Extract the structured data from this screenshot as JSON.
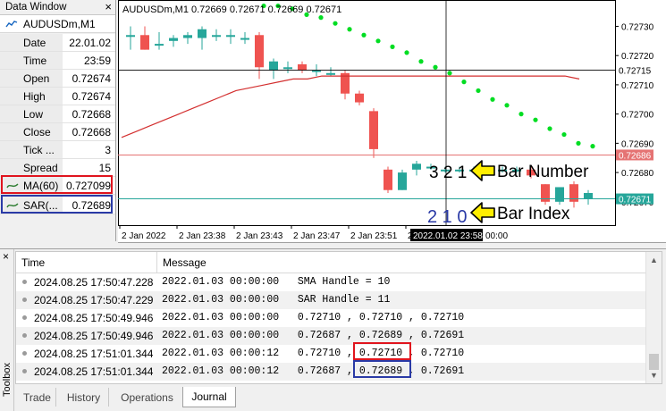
{
  "data_window": {
    "title": "Data Window",
    "close": "×",
    "symbol": "AUDUSDm,M1",
    "rows": [
      {
        "label": "Date",
        "value": "22.01.02"
      },
      {
        "label": "Time",
        "value": "23:59"
      },
      {
        "label": "Open",
        "value": "0.72674"
      },
      {
        "label": "High",
        "value": "0.72674"
      },
      {
        "label": "Low",
        "value": "0.72668"
      },
      {
        "label": "Close",
        "value": "0.72668"
      },
      {
        "label": "Tick ...",
        "value": "3"
      },
      {
        "label": "Spread",
        "value": "15"
      },
      {
        "label": "MA(60)",
        "value": "0.727099"
      },
      {
        "label": "SAR(...",
        "value": "0.72689"
      }
    ]
  },
  "chart": {
    "title": "AUDUSDm,M1  0.72669 0.72671 0.72669 0.72671",
    "crosshair_x_label": "2022.01.02 23:58",
    "x_tick_trailing": "00:00",
    "price_ticks": [
      "0.72730",
      "0.72720",
      "0.72710",
      "0.72700",
      "0.72690",
      "0.72680",
      "0.72670"
    ],
    "time_ticks": [
      "2 Jan 2022",
      "2 Jan 23:38",
      "2 Jan 23:43",
      "2 Jan 23:47",
      "2 Jan 23:51",
      "2 Jan 23:55"
    ],
    "price_tags": {
      "crosshair": "0.72715",
      "red_line": "0.72686",
      "green_line": "0.72671"
    },
    "annotations": {
      "bar_number_digits": "3 2 1",
      "bar_number_label": "Bar Number",
      "bar_index_digits": "2 1 0",
      "bar_index_label": "Bar Index"
    },
    "colors": {
      "bull": "#26a69a",
      "bear": "#ef5350",
      "ma": "#d32f2f",
      "sar": "#00dd22",
      "arrow_fill": "#ffee00",
      "bar_index_text": "#2a3aa6"
    },
    "candles": [
      {
        "o": 0.72727,
        "h": 0.7273,
        "l": 0.72722,
        "c": 0.72727
      },
      {
        "o": 0.72727,
        "h": 0.7273,
        "l": 0.72722,
        "c": 0.72722
      },
      {
        "o": 0.72724,
        "h": 0.72728,
        "l": 0.72722,
        "c": 0.72724
      },
      {
        "o": 0.72725,
        "h": 0.72727,
        "l": 0.72723,
        "c": 0.72726
      },
      {
        "o": 0.72726,
        "h": 0.72728,
        "l": 0.72724,
        "c": 0.72727
      },
      {
        "o": 0.72726,
        "h": 0.7273,
        "l": 0.72722,
        "c": 0.72729
      },
      {
        "o": 0.72727,
        "h": 0.72729,
        "l": 0.72725,
        "c": 0.72727
      },
      {
        "o": 0.72727,
        "h": 0.72729,
        "l": 0.72724,
        "c": 0.72727
      },
      {
        "o": 0.72726,
        "h": 0.72728,
        "l": 0.72724,
        "c": 0.72726
      },
      {
        "o": 0.72727,
        "h": 0.72728,
        "l": 0.72712,
        "c": 0.72716
      },
      {
        "o": 0.72715,
        "h": 0.72719,
        "l": 0.72712,
        "c": 0.72718
      },
      {
        "o": 0.72716,
        "h": 0.72718,
        "l": 0.72714,
        "c": 0.72716
      },
      {
        "o": 0.72717,
        "h": 0.72718,
        "l": 0.72714,
        "c": 0.72715
      },
      {
        "o": 0.72715,
        "h": 0.72717,
        "l": 0.72713,
        "c": 0.72715
      },
      {
        "o": 0.72714,
        "h": 0.72716,
        "l": 0.72713,
        "c": 0.72714
      },
      {
        "o": 0.72714,
        "h": 0.72715,
        "l": 0.72705,
        "c": 0.72707
      },
      {
        "o": 0.72707,
        "h": 0.72708,
        "l": 0.72703,
        "c": 0.72704
      },
      {
        "o": 0.72701,
        "h": 0.72702,
        "l": 0.72685,
        "c": 0.72688
      },
      {
        "o": 0.72681,
        "h": 0.72682,
        "l": 0.72673,
        "c": 0.72674
      },
      {
        "o": 0.72674,
        "h": 0.72681,
        "l": 0.72674,
        "c": 0.7268
      },
      {
        "o": 0.72681,
        "h": 0.72684,
        "l": 0.72679,
        "c": 0.72683
      },
      {
        "o": 0.72682,
        "h": 0.72683,
        "l": 0.72681,
        "c": 0.72682
      },
      {
        "o": 0.72681,
        "h": 0.72682,
        "l": 0.7268,
        "c": 0.72681
      },
      {
        "o": 0.72681,
        "h": 0.72682,
        "l": 0.7268,
        "c": 0.72681
      },
      {
        "o": 0.72681,
        "h": 0.72682,
        "l": 0.7268,
        "c": 0.72681
      },
      {
        "o": 0.72681,
        "h": 0.72682,
        "l": 0.7268,
        "c": 0.72681
      },
      {
        "o": 0.72681,
        "h": 0.72682,
        "l": 0.7268,
        "c": 0.72681
      },
      {
        "o": 0.72681,
        "h": 0.72682,
        "l": 0.7268,
        "c": 0.72681
      },
      {
        "o": 0.72681,
        "h": 0.72682,
        "l": 0.72678,
        "c": 0.72679
      },
      {
        "o": 0.72676,
        "h": 0.72676,
        "l": 0.72669,
        "c": 0.7267
      },
      {
        "o": 0.7267,
        "h": 0.72675,
        "l": 0.72669,
        "c": 0.72675
      },
      {
        "o": 0.72676,
        "h": 0.72677,
        "l": 0.72668,
        "c": 0.7267
      },
      {
        "o": 0.72671,
        "h": 0.72674,
        "l": 0.72669,
        "c": 0.72673
      }
    ],
    "ma60": [
      0.72692,
      0.72694,
      0.72696,
      0.72698,
      0.727,
      0.72702,
      0.72704,
      0.72706,
      0.72708,
      0.72709,
      0.7271,
      0.72711,
      0.72712,
      0.72712,
      0.72713,
      0.72713,
      0.72713,
      0.72713,
      0.72713,
      0.72713,
      0.72713,
      0.72713,
      0.72713,
      0.72713,
      0.72713,
      0.72713,
      0.72713,
      0.72713,
      0.72713,
      0.72713,
      0.72713,
      0.72713,
      0.72712
    ],
    "sar": [
      null,
      null,
      null,
      null,
      null,
      null,
      null,
      null,
      null,
      0.72737,
      0.72737,
      0.72736,
      0.72734,
      0.72733,
      0.72731,
      0.72729,
      0.72727,
      0.72725,
      0.72723,
      0.72721,
      0.72718,
      0.72716,
      0.72714,
      0.72711,
      0.72708,
      0.72705,
      0.72703,
      0.727,
      0.72698,
      0.72695,
      0.72693,
      0.7269,
      0.72689
    ]
  },
  "toolbox": {
    "side_label": "Toolbox",
    "close": "×",
    "columns": [
      "Time",
      "Message"
    ],
    "rows": [
      {
        "time": "2024.08.25 17:50:47.228",
        "msg": "2022.01.03 00:00:00   SMA Handle = 10"
      },
      {
        "time": "2024.08.25 17:50:47.229",
        "msg": "2022.01.03 00:00:00   SAR Handle = 11"
      },
      {
        "time": "2024.08.25 17:50:49.946",
        "msg": "2022.01.03 00:00:00   0.72710 , 0.72710 , 0.72710"
      },
      {
        "time": "2024.08.25 17:50:49.946",
        "msg": "2022.01.03 00:00:00   0.72687 , 0.72689 , 0.72691"
      },
      {
        "time": "2024.08.25 17:51:01.344",
        "msg": "2022.01.03 00:00:12   0.72710 , 0.72710 , 0.72710"
      },
      {
        "time": "2024.08.25 17:51:01.344",
        "msg": "2022.01.03 00:00:12   0.72687 , 0.72689 , 0.72691"
      }
    ],
    "tabs": [
      "Trade",
      "History",
      "Operations",
      "Journal"
    ],
    "active_tab": "Journal"
  }
}
